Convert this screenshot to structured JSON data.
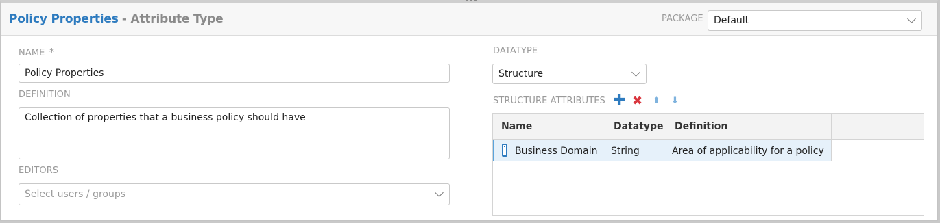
{
  "header": {
    "title_main": "Policy Properties",
    "title_sub": "- Attribute Type",
    "package_label": "PACKAGE",
    "package_value": "Default"
  },
  "form": {
    "name_label": "NAME",
    "required_marker": "*",
    "name_value": "Policy Properties",
    "definition_label": "DEFINITION",
    "definition_value": "Collection of properties that a business policy should have",
    "editors_label": "EDITORS",
    "editors_placeholder": "Select users / groups",
    "datatype_label": "DATATYPE",
    "datatype_value": "Structure"
  },
  "structure": {
    "label": "STRUCTURE ATTRIBUTES",
    "icons": [
      "add-icon",
      "delete-icon",
      "move-up-icon",
      "move-down-icon"
    ],
    "columns": [
      "Name",
      "Datatype",
      "Definition"
    ],
    "rows": [
      {
        "name": "Business Domain",
        "datatype": "String",
        "definition": "Area of applicability for a policy"
      }
    ]
  },
  "colors": {
    "accent": "#2e7bbf",
    "delete": "#d9363e",
    "row_selected": "#e6f1fa"
  }
}
